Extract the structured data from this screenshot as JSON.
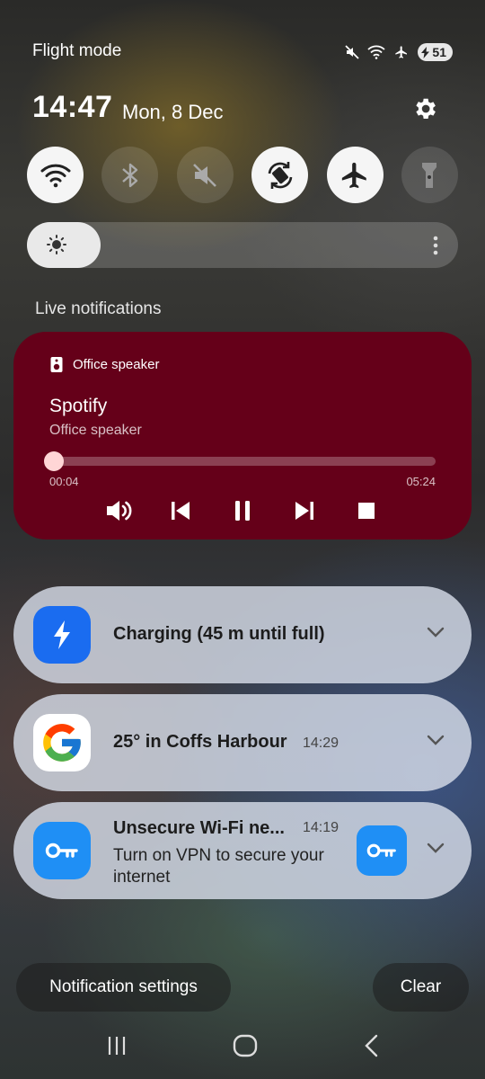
{
  "status_bar": {
    "mode_label": "Flight mode",
    "battery_level": "51",
    "icons": [
      "mute-icon",
      "wifi-icon",
      "airplane-icon",
      "battery-charging-icon"
    ]
  },
  "header": {
    "time": "14:47",
    "date": "Mon, 8 Dec"
  },
  "quick_toggles": [
    {
      "name": "wifi",
      "state": "on"
    },
    {
      "name": "bluetooth",
      "state": "off"
    },
    {
      "name": "sound-mute",
      "state": "off"
    },
    {
      "name": "auto-rotate",
      "state": "on"
    },
    {
      "name": "airplane-mode",
      "state": "on"
    },
    {
      "name": "flashlight",
      "state": "off"
    }
  ],
  "brightness": {
    "level": 0.17
  },
  "live_section": {
    "label": "Live notifications"
  },
  "media": {
    "device": "Office speaker",
    "app": "Spotify",
    "output": "Office speaker",
    "elapsed": "00:04",
    "duration": "05:24",
    "progress": 0.012,
    "card_color": "#650019"
  },
  "notifications": [
    {
      "title": "Charging (45 m until full)",
      "time": "",
      "icon": "charging-bolt-icon",
      "accent": "#1a6cf0"
    },
    {
      "title": "25° in Coffs Harbour",
      "time": "14:29",
      "icon": "google-icon"
    },
    {
      "title": "Unsecure Wi-Fi ne...",
      "time": "14:19",
      "body": "Turn on VPN to secure your internet",
      "icon": "vpn-key-icon",
      "accent": "#1f8ff5"
    }
  ],
  "footer": {
    "settings_label": "Notification settings",
    "clear_label": "Clear"
  },
  "nav": {
    "icons": [
      "recent-apps-icon",
      "home-icon",
      "back-icon"
    ]
  }
}
